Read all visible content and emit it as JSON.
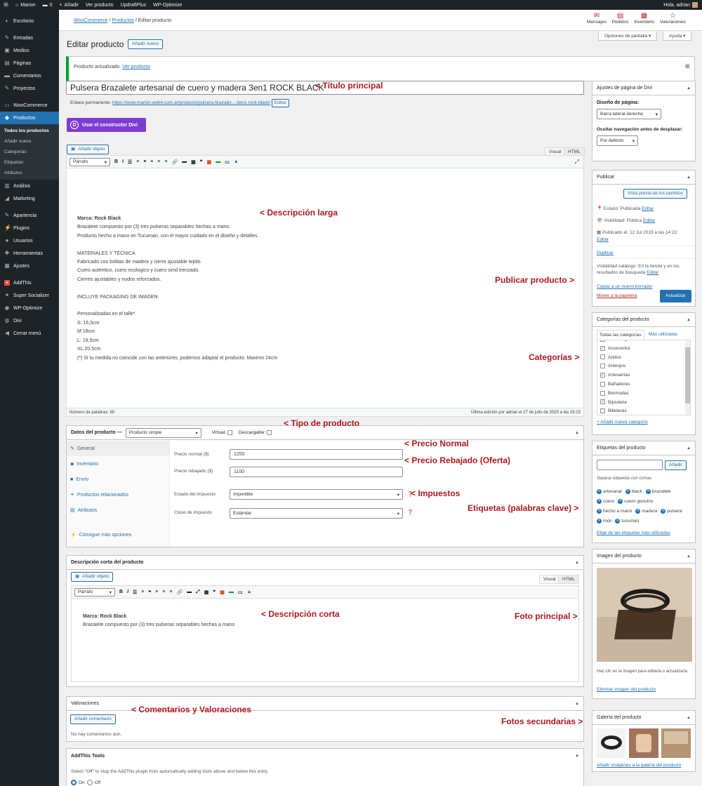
{
  "admin_bar": {
    "site": "Marion",
    "comments": "0",
    "new": "Añadir",
    "view_product": "Ver producto",
    "updraft": "UpdraftPlus",
    "optimize": "WP-Optimize",
    "greeting": "Hola, adrian"
  },
  "sidebar": {
    "items": [
      "Escritorio",
      "Entradas",
      "Medios",
      "Páginas",
      "Comentarios",
      "Proyectos",
      "WooCommerce",
      "Productos",
      "Análisis",
      "Marketing",
      "Apariencia",
      "Plugins",
      "Usuarios",
      "Herramientas",
      "Ajustes",
      "AddThis",
      "Super Socializer",
      "WP-Optimize",
      "Divi",
      "Cerrar menú"
    ],
    "submenu": [
      "Todos los productos",
      "Añadir nuevo",
      "Categorías",
      "Etiquetas",
      "Atributos"
    ]
  },
  "breadcrumb": {
    "woo": "WooCommerce",
    "products": "Productos",
    "current": "Editar producto"
  },
  "top_tabs": [
    "Mensajes",
    "Pedidos",
    "Inventario",
    "Valoraciones"
  ],
  "screen_options": "Opciones de pantalla ▾",
  "help": "Ayuda ▾",
  "page_title": "Editar producto",
  "add_new": "Añadir nuevo",
  "notice": {
    "text": "Producto actualizado.",
    "link": "Ver producto"
  },
  "product": {
    "title": "Pulsera Brazalete artesanal de cuero y madera 3en1 ROCK BLACK",
    "permalink_label": "Enlace permanente:",
    "permalink": "https://www.marion.web4.com.ar/producto/pulsera-brazalet...-3en1-rock-black/",
    "edit": "Editar",
    "divi_btn": "Usar el constructor Divi",
    "add_media": "Añadir objeto",
    "visual": "Visual",
    "html": "HTML",
    "paragraph": "Párrafo",
    "description": [
      "Marca: Rock Black",
      "Brazalete compuesto por (3) tres pulseras separables hechas a mano.",
      "Producto hecho a mano en Tucuman, con el mayor cuidado en el diseño y detalles.",
      "",
      "MATERIALES Y TÉCNICA",
      "Fabricado con bolitas de madera y cierre ajustable tejido.",
      "Cuero autentico, cuero ecologico y cuero simil trenzado.",
      "Cierres ajustables y nudos reforzados.",
      "",
      "INCLUYE PACKAGING DE IMAGEN.",
      "",
      "Personalizadas en el talle*.",
      "S: 16,5cm",
      "M:18cm",
      "L: 19,5cm",
      "XL:20,5cm",
      "(*) Si tu medida no coincide con las anteriores, podemos adaptar el producto. Maximo 24cm"
    ],
    "word_count": "Número de palabras: 80",
    "last_edit": "Última edición por adrian el 27 de julio de 2020 a las 16:23"
  },
  "product_data": {
    "label": "Datos del producto —",
    "type": "Producto simple",
    "virtual": "Virtual:",
    "downloadable": "Descargable:",
    "tabs": [
      "General",
      "Inventario",
      "Envío",
      "Productos relacionados",
      "Atributos",
      "Consigue más opciones"
    ],
    "regular_label": "Precio normal ($)",
    "regular": "1250",
    "sale_label": "Precio rebajado ($)",
    "sale": "1100",
    "tax_status_label": "Estado del impuesto",
    "tax_status": "Imponible",
    "tax_class_label": "Clase de impuesto",
    "tax_class": "Estándar"
  },
  "short_desc": {
    "title": "Descripción corta del producto",
    "lines": [
      "Marca: Rock Black",
      "Brazalete compuesto por (3) tres pulseras separables hechas a mano"
    ]
  },
  "reviews": {
    "title": "Valoraciones",
    "add": "Añadir comentario",
    "none": "No hay comentarios aún."
  },
  "addthis": {
    "title": "AddThis Tools",
    "text": "Select \"Off\" to stop the AddThis plugin from automatically adding tools above and below this entry.",
    "on": "On",
    "off": "Off"
  },
  "divi_box": {
    "title": "Ajustes de página de Divi",
    "layout_label": "Diseño de página:",
    "layout": "Barra lateral derecha",
    "nav_label": "Ocultar navegación antes de desplazar:",
    "nav": "Por defecto"
  },
  "publish": {
    "title": "Publicar",
    "preview": "Vista previa de los cambios",
    "status": "Estado: Publicada",
    "visibility": "Visibilidad: Pública",
    "published": "Publicado el: 12 Jul 2019 a las 14:22",
    "edit": "Editar",
    "duplicate": "Duplicar",
    "catalog": "Visibilidad catálogo: En la tienda y en los resultados de búsqueda",
    "copy": "Copiar a un nuevo borrador",
    "trash": "Mover a la papelera",
    "update": "Actualizar"
  },
  "categories": {
    "title": "Categorías del producto",
    "tab_all": "Todas las categorías",
    "tab_used": "Más utilizadas",
    "items": [
      {
        "name": "Sin categorizar",
        "checked": false
      },
      {
        "name": "Accesorios",
        "checked": true
      },
      {
        "name": "Anillos",
        "checked": false
      },
      {
        "name": "Anteojos",
        "checked": false
      },
      {
        "name": "Artesanías",
        "checked": true
      },
      {
        "name": "Bañadores",
        "checked": false
      },
      {
        "name": "Bermudas",
        "checked": false
      },
      {
        "name": "Bijouterie",
        "checked": true
      },
      {
        "name": "Billeteras",
        "checked": false
      }
    ],
    "add": "+ Añadir nueva categoría"
  },
  "tags": {
    "title": "Etiquetas del producto",
    "add": "Añadir",
    "hint": "Separar etiquetas con comas",
    "items": [
      "artesanal",
      "black",
      "brazalete",
      "cuero",
      "cuero genuino",
      "hecho a mano",
      "madera",
      "pulsera",
      "rock",
      "tucuman"
    ],
    "choose": "Elige de las etiquetas más utilizadas"
  },
  "image": {
    "title": "Imagen del producto",
    "hint": "Haz clic en la imagen para editarla o actualizarla",
    "remove": "Eliminar imagen del producto"
  },
  "gallery": {
    "title": "Galería del producto",
    "add": "Añadir imágenes a la galería del producto"
  },
  "annotations": {
    "titulo": "< Título principal",
    "desc_larga": "< Descripción larga",
    "publicar": "Publicar producto >",
    "categorias": "Categorías >",
    "tipo": "< Tipo de producto",
    "normal": "< Precio Normal",
    "rebajado": "< Precio Rebajado (Oferta)",
    "impuestos": "< Impuestos",
    "etiquetas": "Etiquetas (palabras clave) >",
    "desc_corta": "< Descripción corta",
    "foto": "Foto principal >",
    "comentarios": "< Comentarios y Valoraciones",
    "fotos_sec": "Fotos secundarias >"
  }
}
